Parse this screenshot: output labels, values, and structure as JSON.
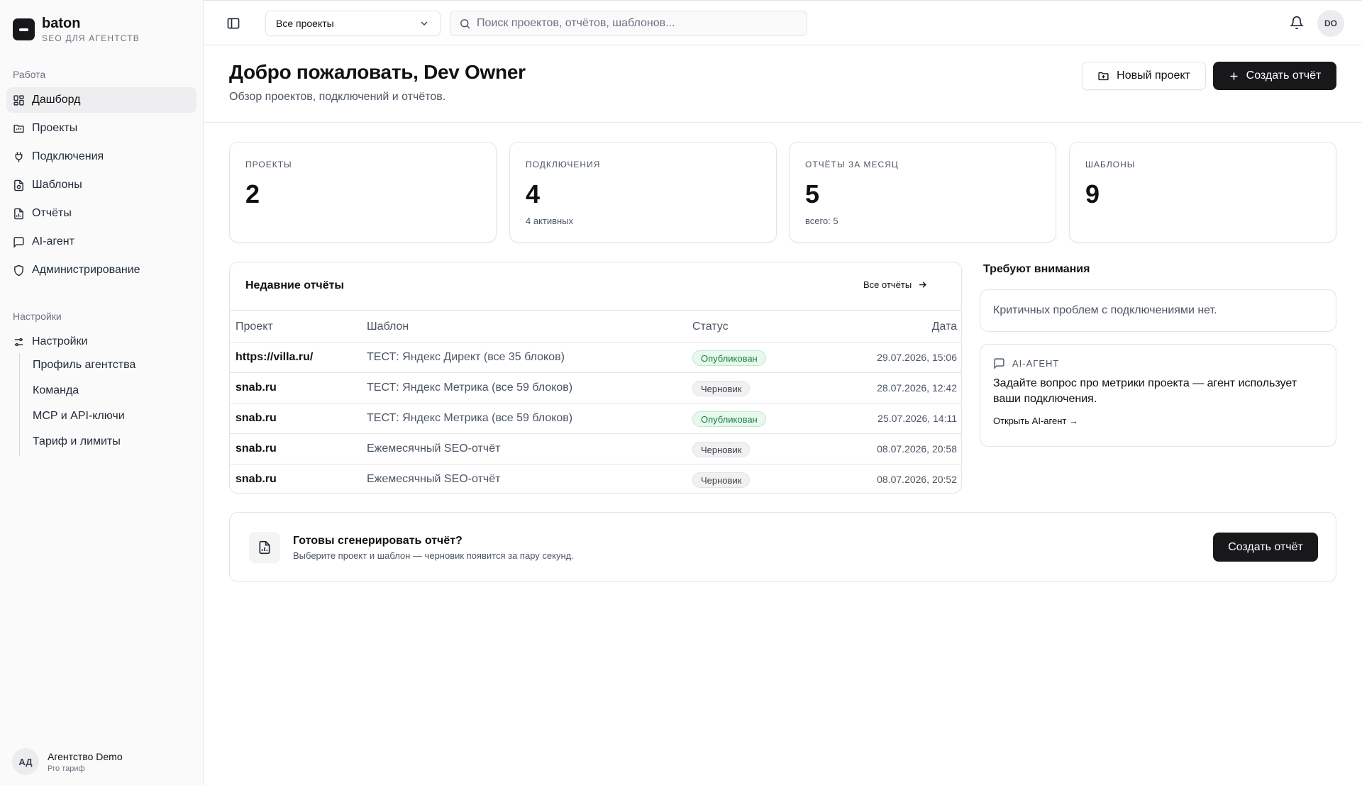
{
  "brand": {
    "name": "baton",
    "subtitle": "SEO ДЛЯ АГЕНТСТВ"
  },
  "sidebar": {
    "section_work": "Работа",
    "items": [
      {
        "label": "Дашборд",
        "icon": "dashboard-icon",
        "active": true
      },
      {
        "label": "Проекты",
        "icon": "folder-icon"
      },
      {
        "label": "Подключения",
        "icon": "plug-icon"
      },
      {
        "label": "Шаблоны",
        "icon": "template-icon"
      },
      {
        "label": "Отчёты",
        "icon": "report-icon"
      },
      {
        "label": "AI-агент",
        "icon": "chat-icon"
      },
      {
        "label": "Администрирование",
        "icon": "shield-icon"
      }
    ],
    "section_settings": "Настройки",
    "settings_label": "Настройки",
    "settings_sub": [
      "Профиль агентства",
      "Команда",
      "MCP и API-ключи",
      "Тариф и лимиты"
    ]
  },
  "account": {
    "initials": "АД",
    "name": "Агентство Demo",
    "plan": "Pro тариф"
  },
  "topbar": {
    "project_select": "Все проекты",
    "search_placeholder": "Поиск проектов, отчётов, шаблонов...",
    "user_initials": "DO"
  },
  "header": {
    "title": "Добро пожаловать, Dev Owner",
    "subtitle": "Обзор проектов, подключений и отчётов.",
    "new_project": "Новый проект",
    "create_report": "Создать отчёт"
  },
  "stats": [
    {
      "label": "ПРОЕКТЫ",
      "value": "2",
      "note": ""
    },
    {
      "label": "ПОДКЛЮЧЕНИЯ",
      "value": "4",
      "note": "4 активных"
    },
    {
      "label": "ОТЧЁТЫ ЗА МЕСЯЦ",
      "value": "5",
      "note": "всего: 5"
    },
    {
      "label": "ШАБЛОНЫ",
      "value": "9",
      "note": ""
    }
  ],
  "recent": {
    "title": "Недавние отчёты",
    "all_link": "Все отчёты",
    "columns": {
      "project": "Проект",
      "template": "Шаблон",
      "status": "Статус",
      "date": "Дата"
    },
    "rows": [
      {
        "project": "https://villa.ru/",
        "template": "ТЕСТ: Яндекс Директ (все 35 блоков)",
        "status": "Опубликован",
        "published": true,
        "date": "29.07.2026, 15:06"
      },
      {
        "project": "snab.ru",
        "template": "ТЕСТ: Яндекс Метрика (все 59 блоков)",
        "status": "Черновик",
        "published": false,
        "date": "28.07.2026, 12:42"
      },
      {
        "project": "snab.ru",
        "template": "ТЕСТ: Яндекс Метрика (все 59 блоков)",
        "status": "Опубликован",
        "published": true,
        "date": "25.07.2026, 14:11"
      },
      {
        "project": "snab.ru",
        "template": "Ежемесячный SEO-отчёт",
        "status": "Черновик",
        "published": false,
        "date": "08.07.2026, 20:58"
      },
      {
        "project": "snab.ru",
        "template": "Ежемесячный SEO-отчёт",
        "status": "Черновик",
        "published": false,
        "date": "08.07.2026, 20:52"
      }
    ]
  },
  "attention": {
    "title": "Требуют внимания",
    "message": "Критичных проблем с подключениями нет.",
    "ai_label": "AI-АГЕНТ",
    "ai_desc": "Задайте вопрос про метрики проекта — агент использует ваши подключения.",
    "ai_link": "Открыть AI-агент →"
  },
  "cta": {
    "title": "Готовы сгенерировать отчёт?",
    "subtitle": "Выберите проект и шаблон — черновик появится за пару секунд.",
    "button": "Создать отчёт"
  }
}
